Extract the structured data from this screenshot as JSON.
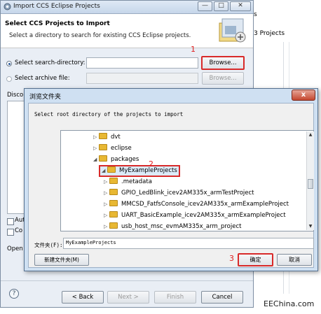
{
  "wizard": {
    "title": "Import CCS Eclipse Projects",
    "minimize": "—",
    "maximize": "□",
    "close": "✕",
    "header_title": "Select CCS Projects to Import",
    "header_subtitle": "Select a directory to search for existing CCS Eclipse projects.",
    "search_dir_label": "Select search-directory:",
    "archive_label": "Select archive file:",
    "browse_label": "Browse...",
    "browse2_label": "Browse...",
    "discovered_label": "Disco",
    "autobuild_label": "Aut",
    "copy_label": "Co",
    "open_label": "Open",
    "help": "?",
    "back_label": "< Back",
    "next_label": "Next >",
    "finish_label": "Finish",
    "cancel_label": "Cancel"
  },
  "background": {
    "projects_text": "3 Projects",
    "s_char": "s"
  },
  "dialog": {
    "title": "浏览文件夹",
    "close": "x",
    "description": "Select root directory of the projects to import",
    "tree": [
      {
        "label": "dvt",
        "twisty": "▷"
      },
      {
        "label": "eclipse",
        "twisty": "▷"
      },
      {
        "label": "packages",
        "twisty": "◢"
      },
      {
        "label": "MyExampleProjects",
        "twisty": "◢"
      },
      {
        "label": ".metadata",
        "twisty": "▷"
      },
      {
        "label": "GPIO_LedBlink_icev2AM335x_armTestProject",
        "twisty": "▷"
      },
      {
        "label": "MMCSD_FatfsConsole_icev2AM335x_armExampleProject",
        "twisty": "▷"
      },
      {
        "label": "UART_BasicExample_icev2AM335x_armExampleProject",
        "twisty": "▷"
      },
      {
        "label": "usb_host_msc_evmAM335x_arm_project",
        "twisty": "▷"
      }
    ],
    "folder_label": "文件夹(F):",
    "folder_value": "MyExampleProjects",
    "new_folder_label": "新建文件夹(M)",
    "ok_label": "确定",
    "cancel_label": "取消"
  },
  "annotations": {
    "one": "1",
    "two": "2",
    "three": "3"
  },
  "watermark": "EEChina.com",
  "colors": {
    "highlight_red": "#d82a2a",
    "folder_yellow": "#e8b833",
    "title_blue": "#cfe0f2"
  },
  "icons": [
    "wizard-app-icon",
    "folder-icon",
    "help-icon",
    "close-icon",
    "wizard-banner-icon"
  ]
}
